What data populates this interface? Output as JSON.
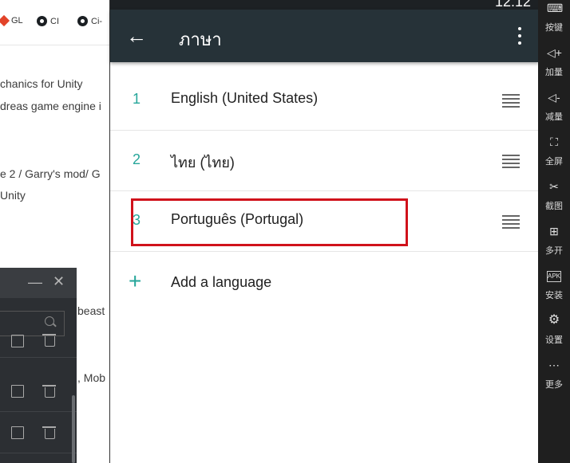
{
  "browser": {
    "bookmarks": [
      "GL",
      "CI",
      "Ci-"
    ],
    "lines": [
      "chanics for Unity",
      "dreas game engine i",
      "e 2 / Garry's mod/ G",
      " Unity",
      "beast",
      ", Mob"
    ]
  },
  "dialog": {
    "minimize_icon": "—",
    "close_icon": "✕"
  },
  "app": {
    "status_time": "12:12",
    "back_icon": "←",
    "title": "ภาษา",
    "languages": [
      {
        "num": "1",
        "name": "English (United States)"
      },
      {
        "num": "2",
        "name": "ไทย (ไทย)"
      },
      {
        "num": "3",
        "name": "Português (Portugal)"
      }
    ],
    "add_icon": "+",
    "add_label": "Add a language",
    "highlight_color": "#d0121b",
    "accent_color": "#26a69a",
    "appbar_color": "#263238"
  },
  "sidebar": [
    {
      "icon": "⌨",
      "label": "按键"
    },
    {
      "icon": "◁+",
      "label": "加量"
    },
    {
      "icon": "◁-",
      "label": "减量"
    },
    {
      "icon": "⛶",
      "label": "全屏"
    },
    {
      "icon": "✂",
      "label": "截图"
    },
    {
      "icon": "⊞",
      "label": "多开"
    },
    {
      "icon": "APK",
      "label": "安装"
    },
    {
      "icon": "⚙",
      "label": "设置"
    },
    {
      "icon": "⋯",
      "label": "更多"
    }
  ]
}
